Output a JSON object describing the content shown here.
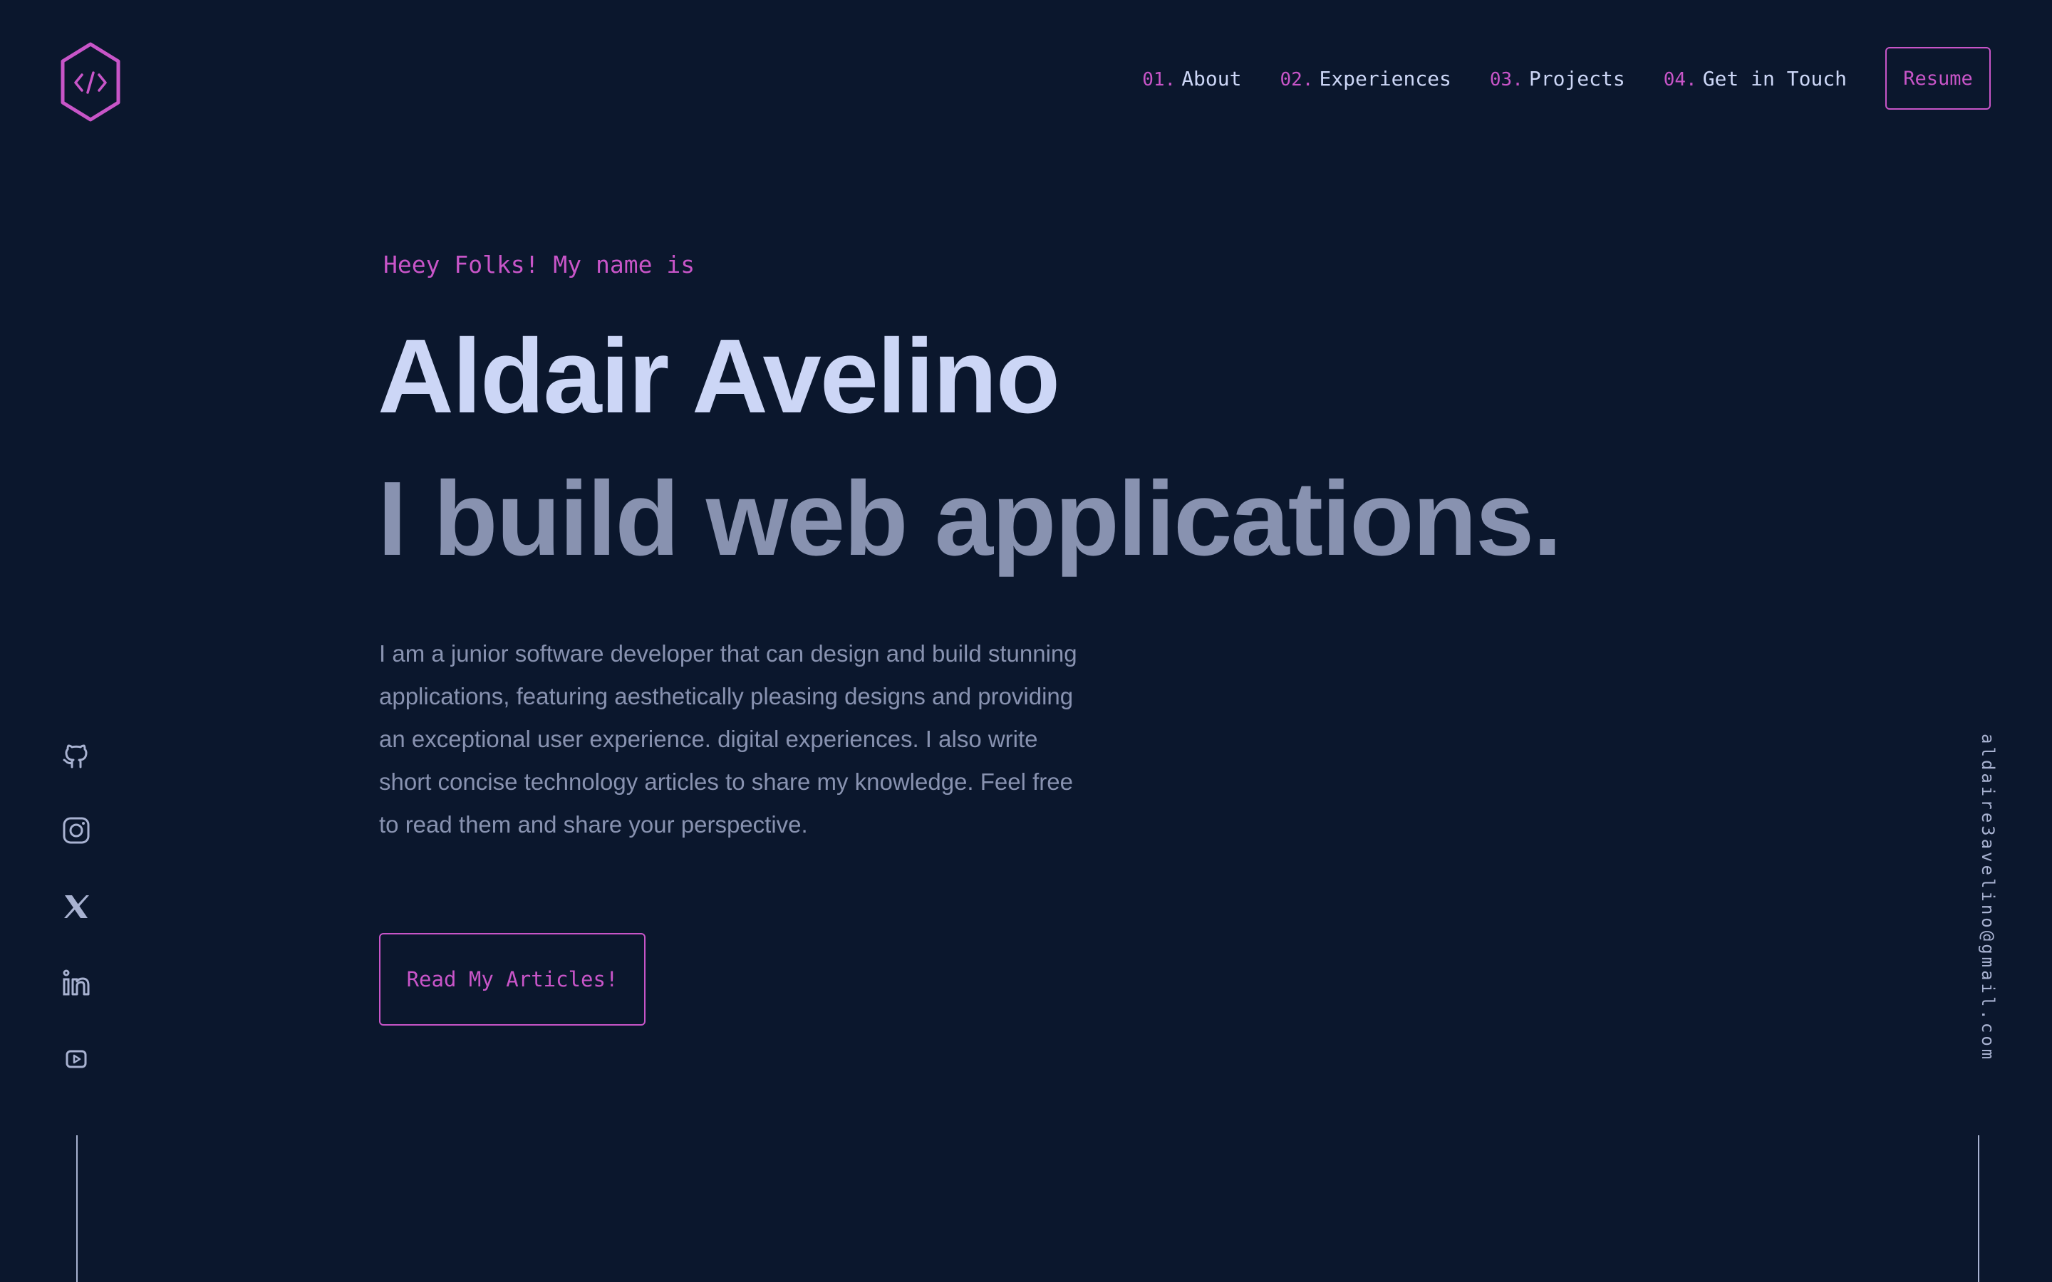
{
  "header": {
    "logo_icon": "code-brackets-hexagon-icon",
    "nav": [
      {
        "number": "01.",
        "label": "About"
      },
      {
        "number": "02.",
        "label": "Experiences"
      },
      {
        "number": "03.",
        "label": "Projects"
      },
      {
        "number": "04.",
        "label": "Get in Touch"
      }
    ],
    "resume_label": "Resume"
  },
  "hero": {
    "greeting": "Heey Folks! My name is",
    "name": "Aldair Avelino",
    "tagline": "I build web applications.",
    "description": "I am a junior software developer that can design and build stunning applications, featuring aesthetically pleasing designs and providing an exceptional user experience. digital experiences. I also write short concise technology articles to share my knowledge. Feel free to read them and share your perspective.",
    "cta_label": "Read My Articles!"
  },
  "social": {
    "icons": [
      "github-icon",
      "instagram-icon",
      "x-twitter-icon",
      "linkedin-icon",
      "youtube-icon"
    ]
  },
  "email": "aldaire3avelino@gmail.com",
  "colors": {
    "background": "#0b172d",
    "accent": "#c855c8",
    "heading": "#ccd6f6",
    "muted": "#8892b0",
    "light_slate": "#a8b2d1"
  }
}
